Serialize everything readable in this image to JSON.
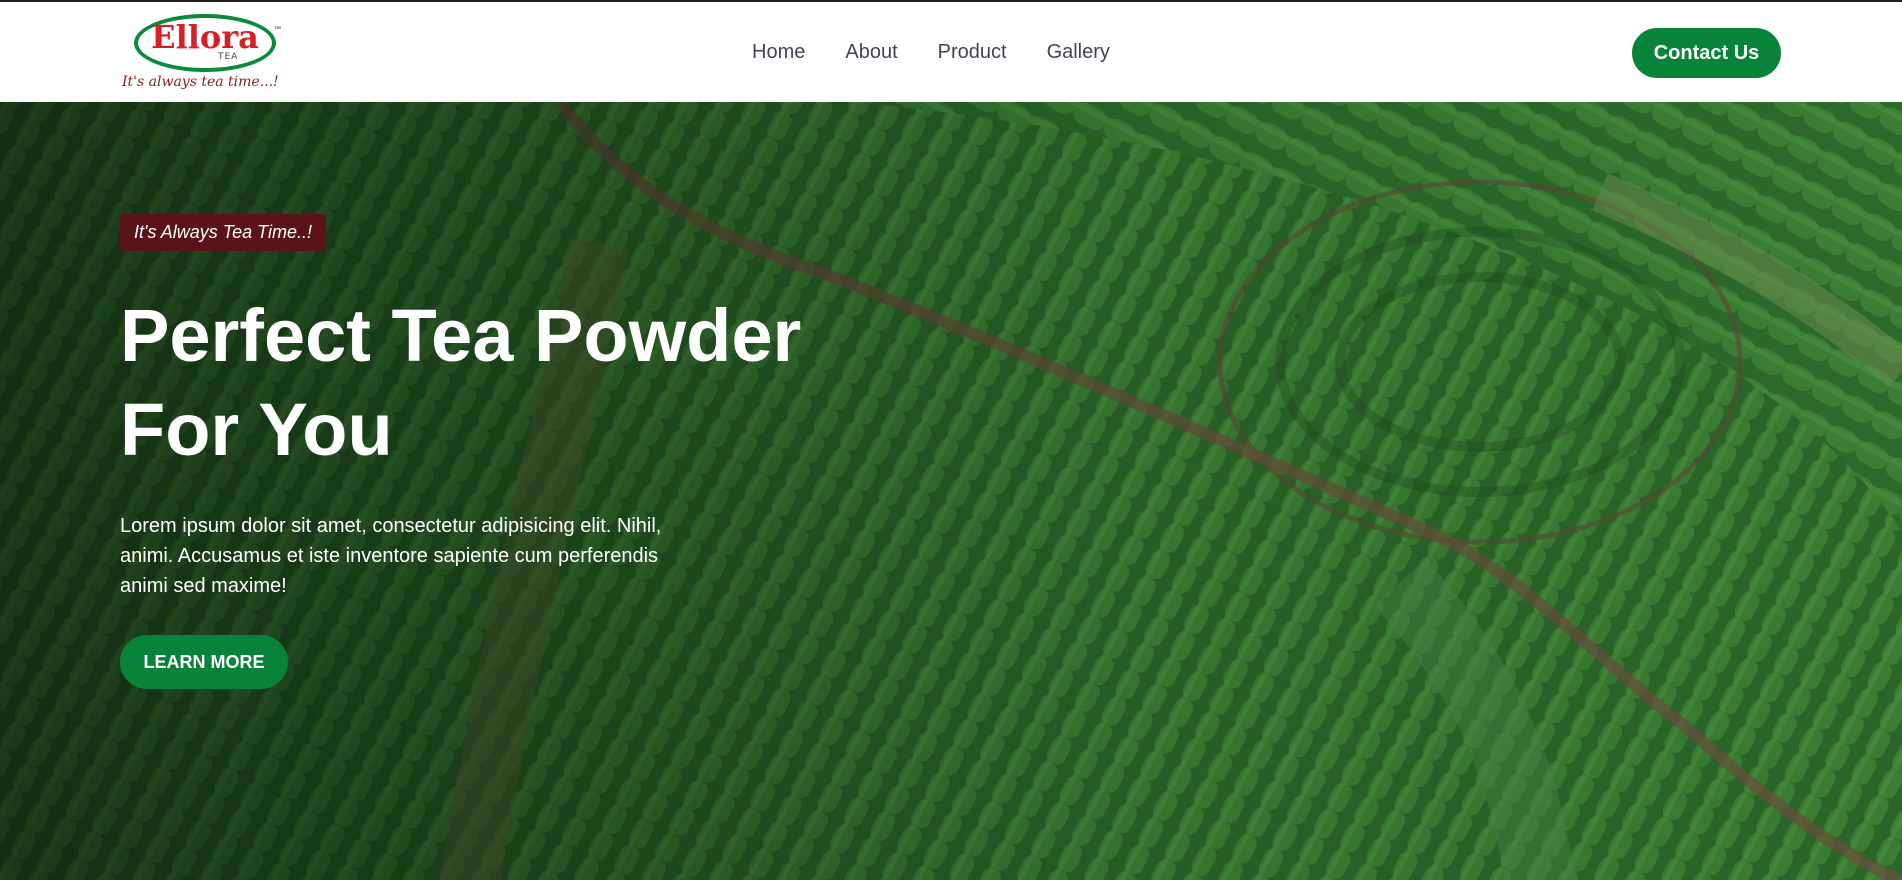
{
  "brand": {
    "logo_text": "Ellora",
    "logo_sub": "TEA",
    "trademark": "™",
    "tagline": "It's always tea time...!"
  },
  "nav": {
    "items": [
      {
        "label": "Home"
      },
      {
        "label": "About"
      },
      {
        "label": "Product"
      },
      {
        "label": "Gallery"
      }
    ],
    "contact_label": "Contact Us"
  },
  "hero": {
    "badge": "It's Always Tea Time..!",
    "title_line1": "Perfect Tea Powder",
    "title_line2": "For You",
    "description": "Lorem ipsum dolor sit amet, consectetur adipisicing elit. Nihil, animi. Accusamus et iste inventore sapiente cum perferendis animi sed maxime!",
    "cta_label": "LEARN MORE"
  },
  "colors": {
    "brand_green": "#08833a",
    "badge_bg": "#5a1418",
    "logo_red": "#d71f26",
    "nav_text": "#3f4652"
  }
}
